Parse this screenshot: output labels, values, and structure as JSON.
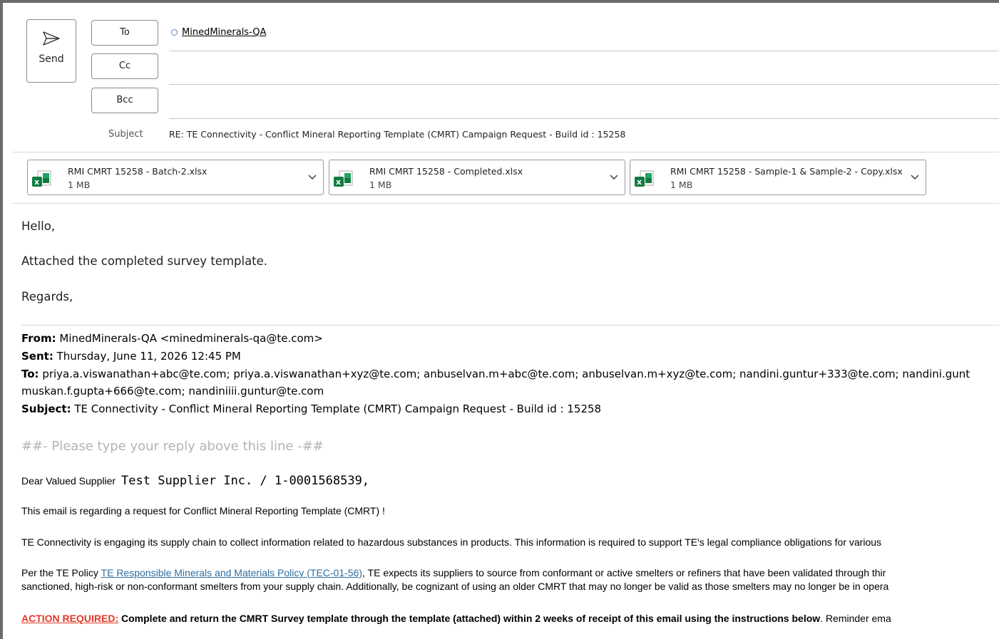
{
  "compose": {
    "send_label": "Send",
    "to_label": "To",
    "cc_label": "Cc",
    "bcc_label": "Bcc",
    "to_recipient": "MinedMinerals-QA",
    "subject_label": "Subject",
    "subject_value": "RE: TE Connectivity - Conflict Mineral Reporting Template (CMRT) Campaign Request -  Build id : 15258"
  },
  "attachments": [
    {
      "name": "RMI CMRT 15258 - Batch-2.xlsx",
      "size": "1 MB"
    },
    {
      "name": "RMI CMRT 15258 - Completed.xlsx",
      "size": "1 MB"
    },
    {
      "name": "RMI CMRT 15258 - Sample-1 & Sample-2 - Copy.xlsx",
      "size": "1 MB"
    }
  ],
  "body": {
    "greeting": "Hello,",
    "line1": "Attached the completed survey template.",
    "closing": "Regards,"
  },
  "quoted": {
    "from_label": "From:",
    "from_value": " MinedMinerals-QA <minedminerals-qa@te.com>",
    "sent_label": "Sent:",
    "sent_value": " Thursday, June 11, 2026 12:45 PM",
    "to_label": "To:",
    "to_value": " priya.a.viswanathan+abc@te.com; priya.a.viswanathan+xyz@te.com; anbuselvan.m+abc@te.com; anbuselvan.m+xyz@te.com; nandini.guntur+333@te.com; nandini.gunt",
    "to_value_2": "muskan.f.gupta+666@te.com; nandiniiii.guntur@te.com",
    "subject_label": "Subject:",
    "subject_value": " TE Connectivity - Conflict Mineral Reporting Template (CMRT) Campaign Request - Build id : 15258",
    "reply_marker": "##- Please type your reply above this line -##",
    "dear": "Dear Valued Supplier",
    "supplier": "Test Supplier Inc. / 1-0001568539,",
    "regarding": "This email is regarding a request for Conflict Mineral Reporting Template (CMRT) !",
    "engaging": "TE Connectivity is engaging its supply chain to collect information related to  hazardous substances in products. This information is required to support TE's legal compliance obligations for various",
    "policy_prefix": "Per the TE Policy ",
    "policy_link": "TE Responsible Minerals and Materials Policy (TEC-01-56)",
    "policy_suffix": ", TE expects its suppliers to source from conformant or active smelters or refiners that have been validated through thir",
    "policy_line2": "sanctioned, high-risk or non-conformant smelters from your supply chain. Additionally, be cognizant of using an older CMRT that may no longer be valid as those smelters may no longer be in opera",
    "action_label": "ACTION REQUIRED:",
    "action_bold": " Complete and return the CMRT Survey template through the template (attached) within 2 weeks of receipt of this email using the instructions below",
    "action_rest": ". Reminder ema"
  }
}
